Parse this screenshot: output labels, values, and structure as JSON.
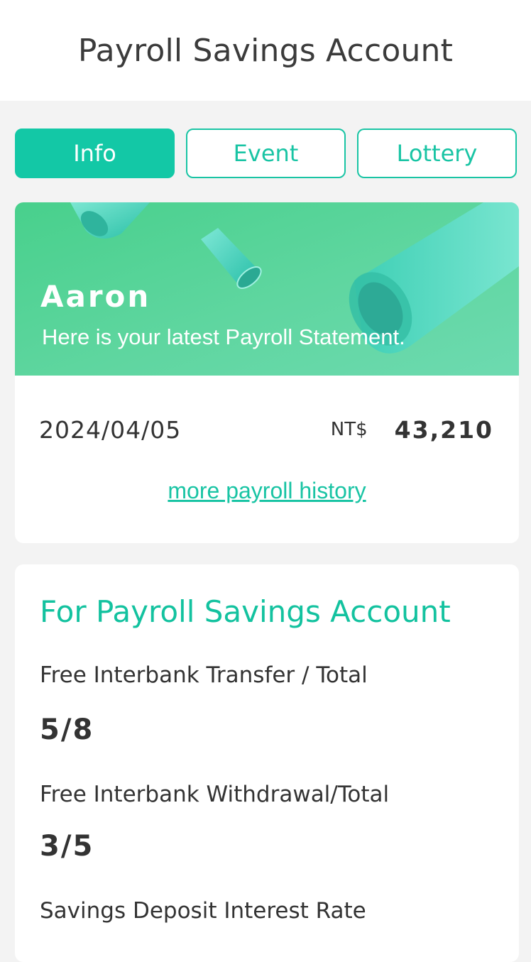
{
  "header": {
    "title": "Payroll Savings Account"
  },
  "tabs": [
    {
      "label": "Info",
      "active": true
    },
    {
      "label": "Event",
      "active": false
    },
    {
      "label": "Lottery",
      "active": false
    }
  ],
  "statement": {
    "name": "Aaron",
    "subtitle": "Here is your latest Payroll Statement.",
    "date": "2024/04/05",
    "currency": "NT$",
    "amount": "43,210",
    "history_link": "more payroll history"
  },
  "benefits": {
    "title": "For Payroll Savings Account",
    "items": [
      {
        "label": "Free Interbank Transfer / Total",
        "value": "5/8"
      },
      {
        "label": "Free Interbank Withdrawal/Total",
        "value": "3/5"
      },
      {
        "label": "Savings Deposit Interest Rate",
        "value": ""
      }
    ]
  },
  "colors": {
    "accent": "#13c8a6",
    "banner": "#52d295",
    "background": "#f3f3f3"
  }
}
